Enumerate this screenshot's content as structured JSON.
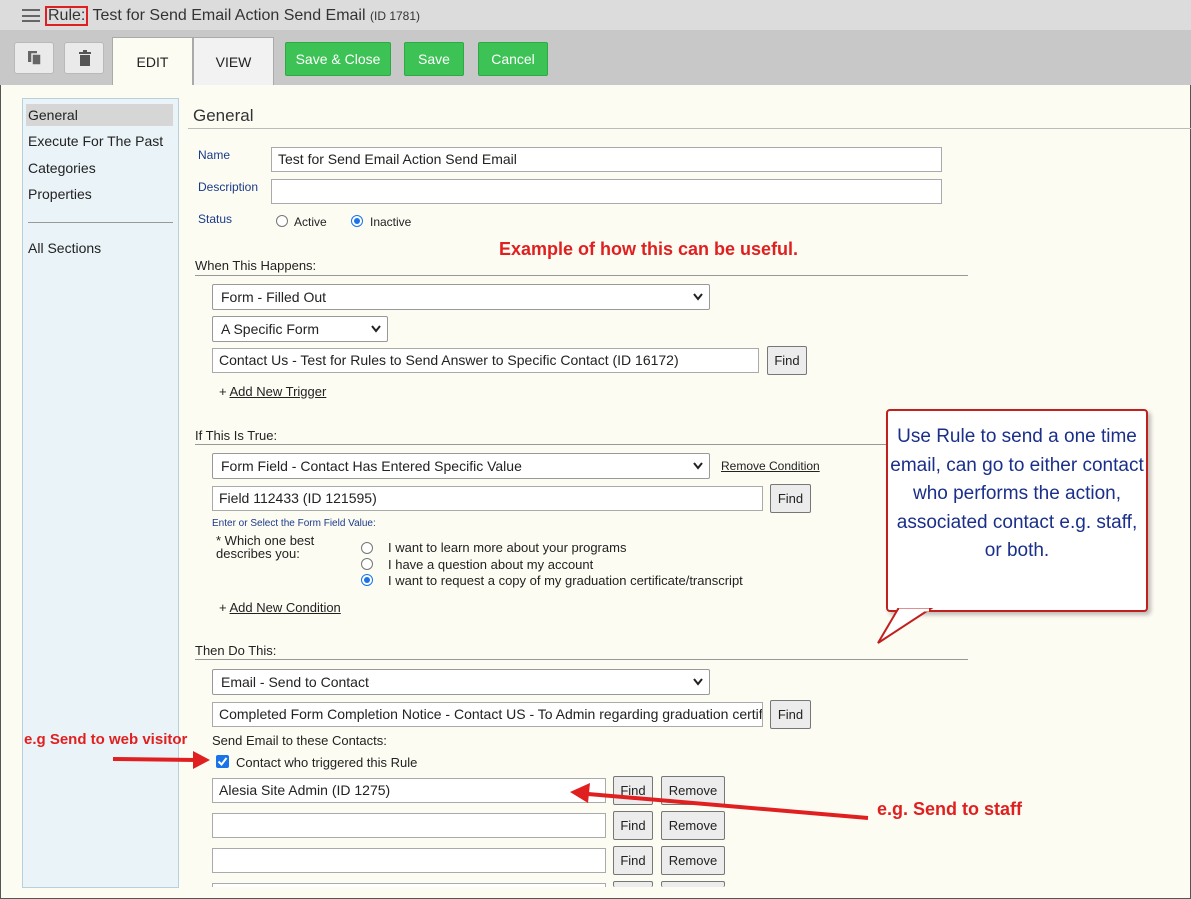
{
  "window": {
    "title_prefix": "Rule:",
    "title": " Test for Send Email Action Send Email",
    "title_id": "(ID 1781)"
  },
  "toolbar": {
    "tabs": [
      "EDIT",
      "VIEW"
    ],
    "save_close": "Save & Close",
    "save": "Save",
    "cancel": "Cancel"
  },
  "sidebar": {
    "items": [
      "General",
      "Execute For The Past",
      "Categories",
      "Properties"
    ],
    "all_sections": "All Sections"
  },
  "general": {
    "section_title": "General",
    "name_label": "Name",
    "name_value": "Test for Send Email Action Send Email",
    "description_label": "Description",
    "description_value": "",
    "status_label": "Status",
    "status_options": [
      "Active",
      "Inactive"
    ],
    "status_selected": "Inactive"
  },
  "when": {
    "header": "When This Happens:",
    "trigger_select": "Form - Filled Out",
    "form_scope_select": "A Specific Form",
    "form_value": "Contact Us - Test for Rules to Send Answer to Specific Contact (ID 16172)",
    "find": "Find",
    "add_trigger": "Add New Trigger"
  },
  "if_true": {
    "header": "If This Is True:",
    "condition_select": "Form Field - Contact Has Entered Specific Value",
    "remove_condition": "Remove Condition",
    "field_value": "Field 112433 (ID 121595)",
    "find": "Find",
    "value_prompt": "Enter or Select the Form Field Value:",
    "question_line1": "* Which one best",
    "question_line2": "describes you:",
    "answers": [
      "I want to learn more about your programs",
      "I have a question about my account",
      "I want to request a copy of my graduation certificate/transcript"
    ],
    "selected_answer_index": 2,
    "add_condition": "Add New Condition"
  },
  "then": {
    "header": "Then Do This:",
    "action_select": "Email - Send to Contact",
    "email_value": "Completed Form Completion Notice - Contact US - To Admin regarding graduation certificate",
    "find": "Find",
    "send_to_label": "Send Email to these Contacts:",
    "trigger_contact_label": "Contact who triggered this Rule",
    "trigger_contact_checked": true,
    "contacts": [
      "Alesia Site Admin (ID 1275)",
      "",
      ""
    ],
    "remove": "Remove"
  },
  "annotations": {
    "example_note": "Example of how this can be useful.",
    "callout": "Use Rule to send a one time email, can go to either contact who performs the action, associated contact e.g. staff, or both.",
    "web_visitor": "e.g Send to web visitor",
    "staff": "e.g. Send to staff"
  },
  "colors": {
    "accent_green": "#3cc255",
    "annotation_red": "#e02020",
    "callout_text": "#1a2f8a",
    "sidebar_bg": "#eaf3f7"
  }
}
